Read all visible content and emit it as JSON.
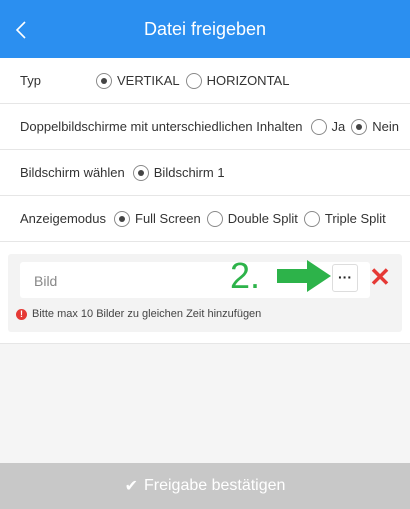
{
  "header": {
    "title": "Datei freigeben",
    "back_icon": "chevron-left-icon"
  },
  "typ": {
    "label": "Typ",
    "options": [
      {
        "label": "VERTIKAL",
        "selected": true
      },
      {
        "label": "HORIZONTAL",
        "selected": false
      }
    ]
  },
  "doppel": {
    "label": "Doppelbildschirme mit unterschiedlichen Inhalten",
    "options": [
      {
        "label": "Ja",
        "selected": false
      },
      {
        "label": "Nein",
        "selected": true
      }
    ]
  },
  "bildschirm": {
    "label": "Bildschirm wählen",
    "options": [
      {
        "label": "Bildschirm 1",
        "selected": true
      }
    ]
  },
  "anzeige": {
    "label": "Anzeigemodus",
    "options": [
      {
        "label": "Full Screen",
        "selected": true
      },
      {
        "label": "Double Split",
        "selected": false
      },
      {
        "label": "Triple Split",
        "selected": false
      }
    ]
  },
  "upload": {
    "placeholder": "Bild",
    "step_label": "2.",
    "more_label": "···",
    "delete_label": "✕",
    "hint": "Bitte max 10 Bilder zu gleichen Zeit hinzufügen",
    "hint_icon": "!"
  },
  "footer": {
    "confirm_label": "Freigabe bestätigen",
    "check": "✔"
  },
  "colors": {
    "header": "#2b8ff0",
    "accent_green": "#2db34a",
    "delete_red": "#e53935",
    "footer_disabled": "#c8c8c8"
  }
}
